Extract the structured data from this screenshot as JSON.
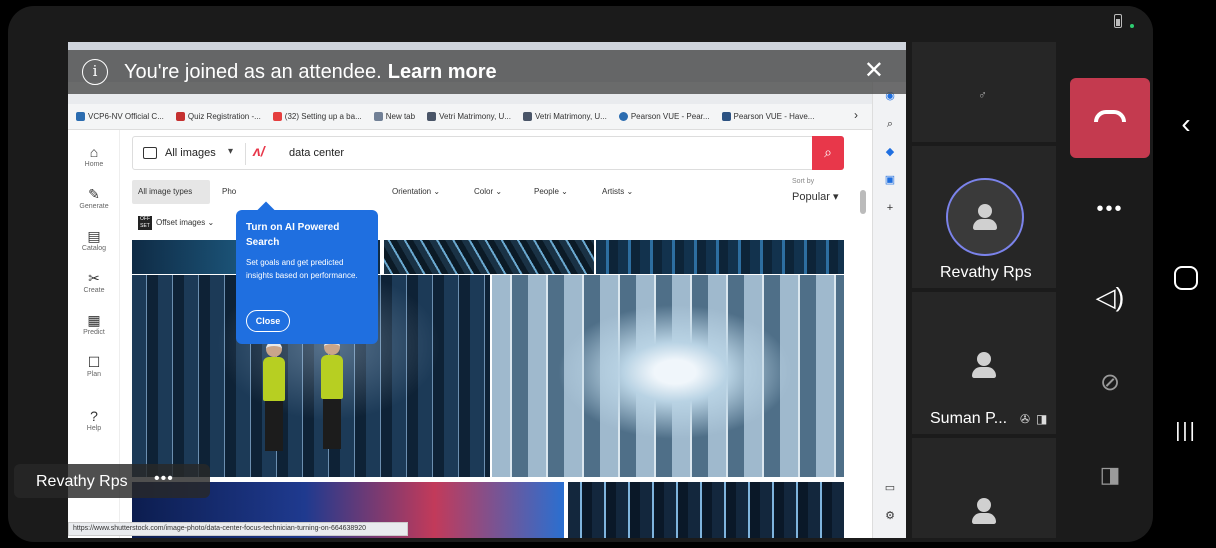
{
  "banner": {
    "info_icon": "info-icon",
    "text": "You're joined as an attendee.",
    "link": "Learn more",
    "close_icon": "close-icon"
  },
  "browser": {
    "bookmarks": [
      {
        "label": "VCP6-NV Official C...",
        "color": "#2b6cb0"
      },
      {
        "label": "Quiz Registration -...",
        "color": "#c53030"
      },
      {
        "label": "(32) Setting up a ba...",
        "color": "#e53e3e"
      },
      {
        "label": "New tab",
        "color": "#718096"
      },
      {
        "label": "Vetri Matrimony, U...",
        "color": "#4a5568"
      },
      {
        "label": "Vetri Matrimony, U...",
        "color": "#4a5568"
      },
      {
        "label": "Pearson VUE - Pear...",
        "color": "#2b6cb0"
      },
      {
        "label": "Pearson VUE - Have...",
        "color": "#2c5282"
      }
    ],
    "bookmarks_more": "›",
    "status_url": "https://www.shutterstock.com/image-photo/data-center-focus-technician-turning-on-664638920"
  },
  "site": {
    "nav": [
      {
        "label": "Home",
        "icon": "⌂"
      },
      {
        "label": "Generate",
        "icon": "✎"
      },
      {
        "label": "Catalog",
        "icon": "▤"
      },
      {
        "label": "Create",
        "icon": "✂"
      },
      {
        "label": "Predict",
        "icon": "▦"
      },
      {
        "label": "Plan",
        "icon": "☐"
      },
      {
        "label": "Help",
        "icon": "?"
      }
    ],
    "search": {
      "type": "All images",
      "caret": "▾",
      "query": "data center"
    },
    "filters": {
      "all_types": "All image types",
      "photos": "Pho",
      "orientation": "Orientation",
      "color": "Color",
      "people": "People",
      "artists": "Artists",
      "sort_label": "Sort by",
      "sort_value": "Popular"
    },
    "offset": {
      "icon_text": "OFF SET",
      "label": "Offset images"
    },
    "popup": {
      "title": "Turn on AI Powered Search",
      "body": "Set goals and get predicted insights based on performance.",
      "close": "Close"
    }
  },
  "participants": [
    {
      "name": ""
    },
    {
      "name": "Revathy Rps"
    },
    {
      "name": "Suman P..."
    },
    {
      "name": ""
    }
  ],
  "presenter_label": "Revathy Rps",
  "presenter_more": "•••",
  "controls": {
    "more": "•••",
    "speaker": "◁)",
    "mic": "🎙",
    "camera": "▣"
  },
  "android_nav": {
    "back": "‹",
    "recents": "|||"
  }
}
